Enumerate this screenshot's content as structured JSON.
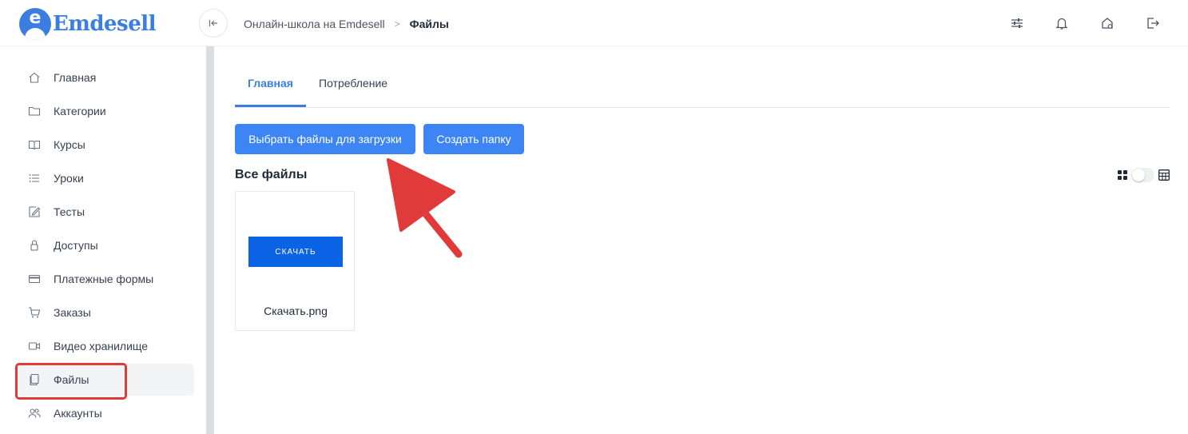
{
  "brand": {
    "name": "Emdesell",
    "badge_letter": "e",
    "color": "#3b7de0"
  },
  "header": {
    "breadcrumb": [
      "Онлайн-школа на Emdesell",
      "Файлы"
    ],
    "icons": [
      "settings-sliders-icon",
      "bell-icon",
      "home-settings-icon",
      "logout-icon"
    ]
  },
  "sidebar": {
    "items": [
      {
        "label": "Главная",
        "icon": "home-icon",
        "active": false
      },
      {
        "label": "Категории",
        "icon": "folder-icon",
        "active": false
      },
      {
        "label": "Курсы",
        "icon": "book-icon",
        "active": false
      },
      {
        "label": "Уроки",
        "icon": "list-icon",
        "active": false
      },
      {
        "label": "Тесты",
        "icon": "edit-icon",
        "active": false
      },
      {
        "label": "Доступы",
        "icon": "lock-icon",
        "active": false
      },
      {
        "label": "Платежные формы",
        "icon": "credit-card-icon",
        "active": false
      },
      {
        "label": "Заказы",
        "icon": "cart-icon",
        "active": false
      },
      {
        "label": "Видео хранилище",
        "icon": "video-icon",
        "active": false
      },
      {
        "label": "Файлы",
        "icon": "files-icon",
        "active": true
      },
      {
        "label": "Аккаунты",
        "icon": "users-icon",
        "active": false
      }
    ]
  },
  "main": {
    "tabs": [
      {
        "label": "Главная",
        "active": true
      },
      {
        "label": "Потребление",
        "active": false
      }
    ],
    "buttons": {
      "upload": "Выбрать файлы для загрузки",
      "create_folder": "Создать папку"
    },
    "section_title": "Все файлы",
    "files": [
      {
        "name": "Скачать.png",
        "preview_text": "СКАЧАТЬ"
      }
    ]
  },
  "colors": {
    "accent": "#3d85f5",
    "annotation_red": "#e03a3a",
    "thumb_blue": "#0b63e5"
  }
}
